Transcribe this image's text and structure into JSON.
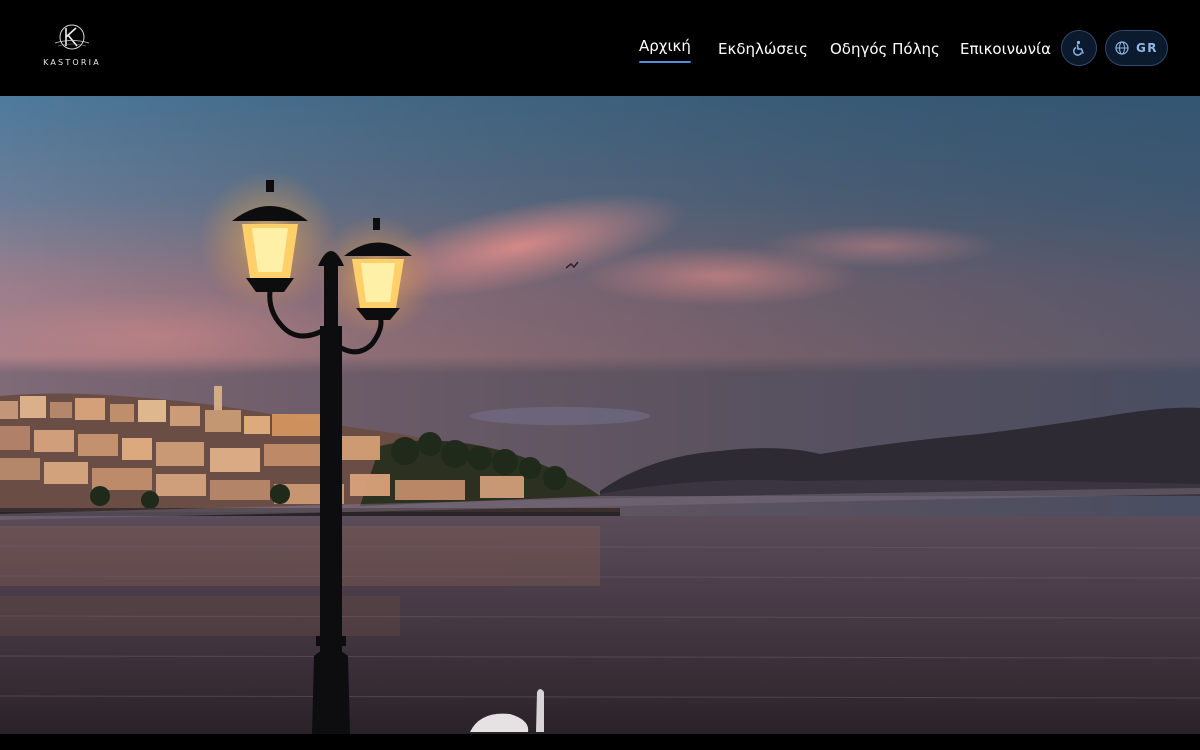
{
  "brand": {
    "name": "KASTORIA",
    "colors": {
      "accent": "#4d8fd9",
      "button_bg": "#0b1a2c",
      "button_border": "#2b4a6d"
    }
  },
  "nav": {
    "items": [
      {
        "label": "Αρχική",
        "active": true
      },
      {
        "label": "Εκδηλώσεις",
        "active": false
      },
      {
        "label": "Οδηγός Πόλης",
        "active": false
      },
      {
        "label": "Επικοινωνία",
        "active": false
      }
    ]
  },
  "accessibility": {
    "icon": "accessibility-icon"
  },
  "language": {
    "icon": "globe-icon",
    "code": "GR"
  },
  "hero": {
    "image": "kastoria-lake-sunset-with-street-lamp"
  }
}
